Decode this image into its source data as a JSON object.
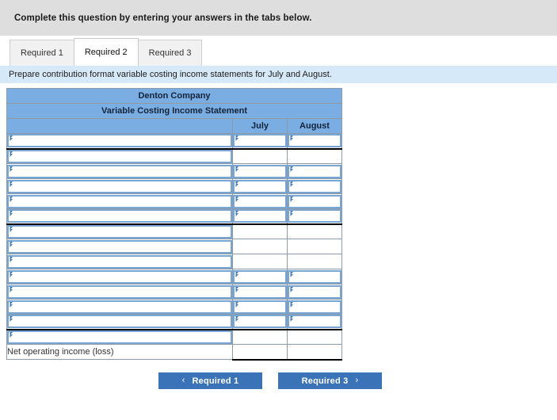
{
  "banner": {
    "text": "Complete this question by entering your answers in the tabs below."
  },
  "tabs": [
    {
      "label": "Required 1",
      "active": false
    },
    {
      "label": "Required 2",
      "active": true
    },
    {
      "label": "Required 3",
      "active": false
    }
  ],
  "subbar": {
    "text": "Prepare contribution format variable costing income statements for July and August."
  },
  "worksheet": {
    "title_line1": "Denton Company",
    "title_line2": "Variable Costing Income Statement",
    "col_label_header": "",
    "col_headers": [
      "July",
      "August"
    ],
    "rows": [
      {
        "label": "",
        "label_type": "dropdown",
        "july": "",
        "august": "",
        "cell_type": "dropdown",
        "rule_bottom": true
      },
      {
        "label": "",
        "label_type": "dropdown",
        "july": "",
        "august": "",
        "cell_type": "plain",
        "rule_bottom": false
      },
      {
        "label": "",
        "label_type": "dropdown",
        "july": "",
        "august": "",
        "cell_type": "dropdown",
        "rule_bottom": false
      },
      {
        "label": "",
        "label_type": "dropdown",
        "july": "",
        "august": "",
        "cell_type": "dropdown",
        "rule_bottom": false
      },
      {
        "label": "",
        "label_type": "dropdown",
        "july": "",
        "august": "",
        "cell_type": "dropdown",
        "rule_bottom": false
      },
      {
        "label": "",
        "label_type": "dropdown",
        "july": "",
        "august": "",
        "cell_type": "dropdown",
        "rule_bottom": true
      },
      {
        "label": "",
        "label_type": "dropdown",
        "july": "",
        "august": "",
        "cell_type": "plain",
        "rule_bottom": false
      },
      {
        "label": "",
        "label_type": "dropdown",
        "july": "",
        "august": "",
        "cell_type": "plain",
        "rule_bottom": false
      },
      {
        "label": "",
        "label_type": "dropdown",
        "july": "",
        "august": "",
        "cell_type": "plain",
        "rule_bottom": false
      },
      {
        "label": "",
        "label_type": "dropdown",
        "july": "",
        "august": "",
        "cell_type": "dropdown",
        "rule_bottom": false
      },
      {
        "label": "",
        "label_type": "dropdown",
        "july": "",
        "august": "",
        "cell_type": "dropdown",
        "rule_bottom": false
      },
      {
        "label": "",
        "label_type": "dropdown",
        "july": "",
        "august": "",
        "cell_type": "dropdown",
        "rule_bottom": false
      },
      {
        "label": "",
        "label_type": "dropdown",
        "july": "",
        "august": "",
        "cell_type": "dropdown",
        "rule_bottom": true
      },
      {
        "label": "",
        "label_type": "dropdown",
        "july": "",
        "august": "",
        "cell_type": "plain",
        "rule_bottom": false
      },
      {
        "label": "Net operating income (loss)",
        "label_type": "static",
        "july": "",
        "august": "",
        "cell_type": "plain",
        "rule_bottom": true
      }
    ]
  },
  "footer": {
    "prev_label": "Required 1",
    "prev_icon": "chevron-left-icon",
    "prev_chevron": "‹",
    "next_label": "Required 3",
    "next_icon": "chevron-right-icon",
    "next_chevron": "›"
  },
  "colors": {
    "banner_bg": "#dedede",
    "subbar_bg": "#d6e9f8",
    "table_header_bg": "#7aaee3",
    "button_bg": "#3b73b9",
    "dropdown_border": "#78a5d2"
  }
}
